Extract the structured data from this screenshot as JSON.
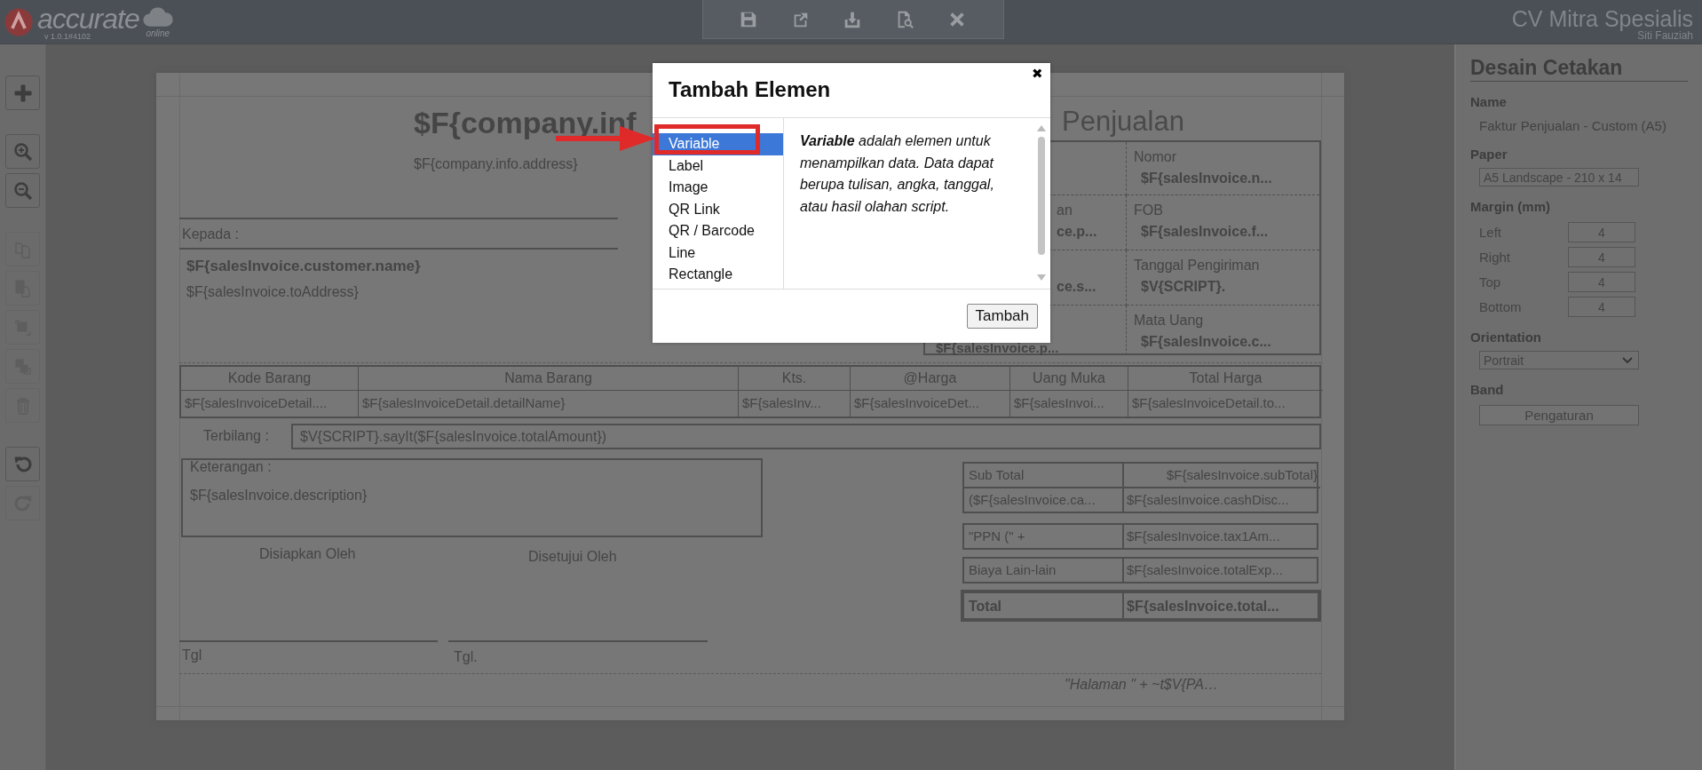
{
  "app": {
    "logo_text": "accurate",
    "version": "v 1.0.1#4102",
    "edition": "online",
    "company": "CV Mitra Spesialis",
    "user": "Siti Fauziah"
  },
  "left_toolbar": [
    {
      "kind": "add",
      "disabled": false
    },
    {
      "kind": "zoom-in",
      "disabled": false
    },
    {
      "kind": "zoom-out",
      "disabled": false
    },
    {
      "kind": "copy",
      "disabled": true
    },
    {
      "kind": "paste",
      "disabled": true
    },
    {
      "kind": "front",
      "disabled": true
    },
    {
      "kind": "back",
      "disabled": true
    },
    {
      "kind": "delete",
      "disabled": true
    },
    {
      "kind": "undo",
      "disabled": false
    },
    {
      "kind": "redo",
      "disabled": true
    }
  ],
  "report": {
    "company_name": "$F{company.inf",
    "company_address": "$F{company.info.address}",
    "title": "Penjualan",
    "info_rows": [
      {
        "right_label": "Nomor",
        "right_value": "$F{salesInvoice.n..."
      },
      {
        "left_label": "an",
        "left_value": "ce.p...",
        "right_label": "FOB",
        "right_value": "$F{salesInvoice.f..."
      },
      {
        "left_value": "ce.s...",
        "right_label": "Tanggal Pengiriman",
        "right_value": "$V{SCRIPT}."
      },
      {
        "left_value": "$F{salesInvoice.p...",
        "right_label": "Mata Uang",
        "right_value": "$F{salesInvoice.c..."
      }
    ],
    "to_label": "Kepada :",
    "customer_name": "$F{salesInvoice.customer.name}",
    "customer_address": "$F{salesInvoice.toAddress}",
    "items_table": {
      "columns": [
        "Kode Barang",
        "Nama Barang",
        "Kts.",
        "@Harga",
        "Uang Muka",
        "Total Harga"
      ],
      "row": [
        "$F{salesInvoiceDetail....",
        "$F{salesInvoiceDetail.detailName}",
        "$F{salesInv...",
        "$F{salesInvoiceDet...",
        "$F{salesInvoi...",
        "$F{salesInvoiceDetail.to..."
      ]
    },
    "terbilang": {
      "label": "Terbilang :",
      "value": "$V{SCRIPT}.sayIt($F{salesInvoice.totalAmount})"
    },
    "keterangan": {
      "label": "Keterangan :",
      "value": "$F{salesInvoice.description}"
    },
    "signatures": [
      {
        "title": "Disiapkan Oleh",
        "date_label": "Tgl"
      },
      {
        "title": "Disetujui Oleh",
        "date_label": "Tgl."
      }
    ],
    "summary_boxes": [
      {
        "kind": "normal",
        "rows": [
          {
            "label": "Sub Total",
            "value": "$F{salesInvoice.subTotal}"
          },
          {
            "label": "($F{salesInvoice.ca...",
            "value": "$F{salesInvoice.cashDisc..."
          }
        ]
      },
      {
        "kind": "normal",
        "rows": [
          {
            "label": "\"PPN (\" +",
            "value": "$F{salesInvoice.tax1Am..."
          }
        ]
      },
      {
        "kind": "normal",
        "rows": [
          {
            "label": "Biaya Lain-lain",
            "value": "$F{salesInvoice.totalExp..."
          }
        ]
      },
      {
        "kind": "total",
        "rows": [
          {
            "label": "Total",
            "value": "$F{salesInvoice.total..."
          }
        ]
      }
    ],
    "page_footer": "\"Halaman \" +  ~t$V{PA…"
  },
  "panel": {
    "title": "Desain Cetakan",
    "name_label": "Name",
    "name_value": "Faktur Penjualan - Custom (A5)",
    "paper_label": "Paper",
    "paper_value": "A5 Landscape - 210 x 14",
    "margin_label": "Margin (mm)",
    "margins": [
      {
        "label": "Left",
        "value": "4"
      },
      {
        "label": "Right",
        "value": "4"
      },
      {
        "label": "Top",
        "value": "4"
      },
      {
        "label": "Bottom",
        "value": "4"
      }
    ],
    "orientation_label": "Orientation",
    "orientation_value": "Portrait",
    "band_label": "Band",
    "band_button": "Pengaturan"
  },
  "dialog": {
    "title": "Tambah Elemen",
    "close": "✖",
    "items": [
      {
        "label": "Variable",
        "selected": true
      },
      {
        "label": "Label",
        "selected": false
      },
      {
        "label": "Image",
        "selected": false
      },
      {
        "label": "QR Link",
        "selected": false
      },
      {
        "label": "QR / Barcode",
        "selected": false
      },
      {
        "label": "Line",
        "selected": false
      },
      {
        "label": "Rectangle",
        "selected": false
      }
    ],
    "description": "**Variable** adalah elemen untuk menampilkan data. Data dapat berupa tulisan, angka, tanggal, atau hasil olahan script.",
    "button": "Tambah"
  }
}
